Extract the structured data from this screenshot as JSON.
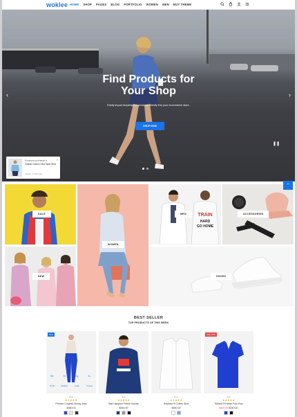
{
  "header": {
    "logo": "woklee",
    "nav": [
      "HOME",
      "SHOP",
      "PAGES",
      "BLOG",
      "PORTFOLIO",
      "WOMEN",
      "MEN",
      "BUY THEME"
    ],
    "active_nav": "HOME",
    "icons": [
      "search-icon",
      "cart-icon",
      "user-icon",
      "menu-icon"
    ],
    "accent_color": "#1a73e8"
  },
  "hero": {
    "title_line1": "Find Products for",
    "title_line2": "Your Shop",
    "subtitle": "Easily import dropshipped products directly into your ecommerce store.",
    "cta": "SHOP NOW",
    "slides": 2,
    "active_slide": 1
  },
  "popup": {
    "line1": "Someone purchased a",
    "line2": "Classic Cotton Crew Sport Shirt",
    "line3": "Vesper, 1 hour ago"
  },
  "categories": {
    "sale": "SALE",
    "women": "WOMEN",
    "men": "MEN",
    "accessories": "ACCESSORIES",
    "new": "NEW",
    "shoes": "SHOES"
  },
  "best_seller": {
    "title": "BEST SELLER",
    "subtitle": "TOP PRODUCTS OF THIS WEEK",
    "products": [
      {
        "badge": "New",
        "badge_color": "#1a73e8",
        "brand": "Style",
        "stars": "★★★★★",
        "name": "Premier Cropped Skinny Jean",
        "price": "$380.00",
        "sizes": [
          {
            "size": "Sm",
            "label": "Small"
          },
          {
            "size": "M",
            "label": "Medium"
          },
          {
            "size": "Lg",
            "label": "Large"
          },
          {
            "size": "XL",
            "label": "X-Large"
          }
        ]
      },
      {
        "badge": "",
        "brand": "Style",
        "stars": "★★★★★",
        "name": "Bad Hampton Fleece Hoodie",
        "price": "$440.00"
      },
      {
        "badge": "",
        "brand": "Style",
        "stars": "★★★★★",
        "name": "Relaxed Fit Cotton Shirt",
        "price": "$480.00"
      },
      {
        "badge": "Sale 15%",
        "badge_color": "#e24b4b",
        "brand": "Style",
        "stars": "★★★★★",
        "name": "Tailored Fit Mesh Polo Polo",
        "price_old": "$420.00",
        "price": "$340.00"
      }
    ]
  }
}
